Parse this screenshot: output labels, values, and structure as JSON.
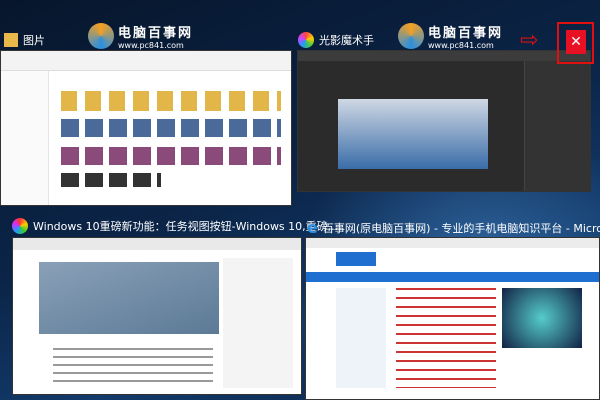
{
  "watermark": {
    "name": "电脑百事网",
    "url": "www.pc841.com"
  },
  "windows": [
    {
      "title": "图片",
      "icon": "folder-icon"
    },
    {
      "title": "光影魔术手",
      "icon": "aperture-icon"
    },
    {
      "title": "Windows 10重磅新功能：任务视图按钮-Windows 10,重磅,...",
      "icon": "browser-icon"
    },
    {
      "title": "百事网(原电脑百事网) - 专业的手机电脑知识平台 - Microso...",
      "icon": "edge-icon"
    }
  ],
  "close_label": "✕",
  "colors": {
    "close": "#e81123",
    "annotation": "#e01010"
  }
}
